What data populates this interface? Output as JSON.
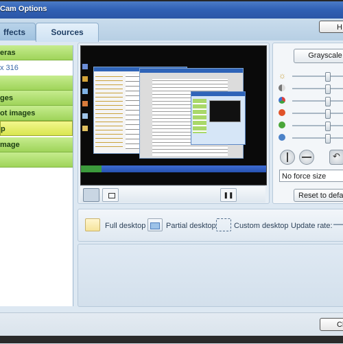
{
  "window": {
    "title": "Cam Options"
  },
  "tabs": [
    {
      "label": "ffects"
    },
    {
      "label": "Sources"
    }
  ],
  "help_button": {
    "label": "H"
  },
  "sidebar": {
    "items": [
      {
        "label": "eras"
      },
      {
        "label": "x 316"
      },
      {
        "label": ""
      },
      {
        "label": "ges"
      },
      {
        "label": "ot images"
      },
      {
        "label": "p"
      },
      {
        "label": "mage"
      },
      {
        "label": ""
      }
    ]
  },
  "preview_controls": {
    "pause_symbol": "❚❚"
  },
  "adjustments": {
    "grayscale_label": "Grayscale",
    "sliders": [
      {
        "icon": "brightness-icon",
        "color": "#c8a13c",
        "level": 0.6
      },
      {
        "icon": "contrast-icon",
        "color": "#777777",
        "level": 0.6
      },
      {
        "icon": "color-icon",
        "color": "#c05050",
        "level": 0.6
      },
      {
        "icon": "red-icon",
        "color": "#e0532a",
        "level": 0.6
      },
      {
        "icon": "green-icon",
        "color": "#4aa63a",
        "level": 0.6
      },
      {
        "icon": "blue-icon",
        "color": "#4c82c8",
        "level": 0.6
      }
    ],
    "force_size_value": "No force size",
    "reset_label": "Reset to defaul"
  },
  "sources": {
    "full_desktop": "Full desktop",
    "partial_desktop": "Partial desktop",
    "custom_desktop": "Custom desktop",
    "update_rate": "Update rate:"
  },
  "footer": {
    "close_label": "Cl"
  },
  "colors": {
    "titlebar": "#2f5fb3",
    "sidebar_item": "#9fd45a",
    "sidebar_selected": "#d9e64f",
    "accent": "#1f3f66"
  }
}
